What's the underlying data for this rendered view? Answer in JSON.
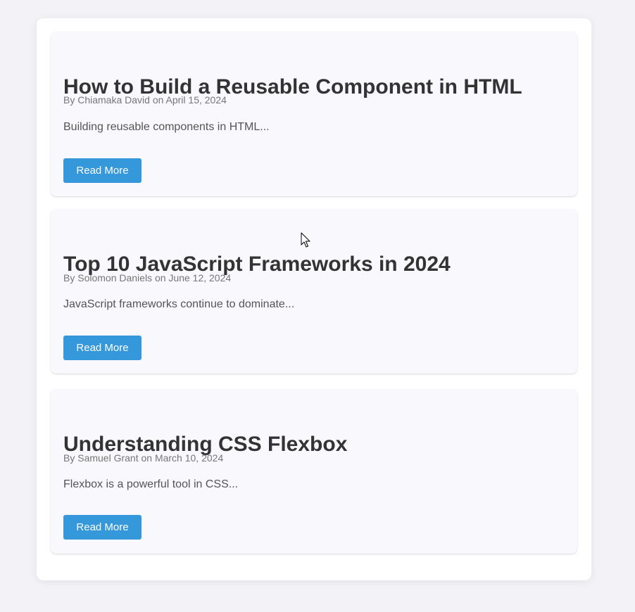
{
  "colors": {
    "page_background": "#f3f3f7",
    "card_background": "#ffffff",
    "post_background": "#f8f8fd",
    "button": "#3498db",
    "title": "#333333",
    "meta": "#777777",
    "excerpt": "#555555"
  },
  "posts": [
    {
      "title": "How to Build a Reusable Component in HTML",
      "meta": "By Chiamaka David on April 15, 2024",
      "excerpt": "Building reusable components in HTML...",
      "button_label": "Read More"
    },
    {
      "title": "Top 10 JavaScript Frameworks in 2024",
      "meta": "By Solomon Daniels on June 12, 2024",
      "excerpt": "JavaScript frameworks continue to dominate...",
      "button_label": "Read More"
    },
    {
      "title": "Understanding CSS Flexbox",
      "meta": "By Samuel Grant on March 10, 2024",
      "excerpt": "Flexbox is a powerful tool in CSS...",
      "button_label": "Read More"
    }
  ],
  "cursor": {
    "icon": "mouse-pointer-icon"
  }
}
